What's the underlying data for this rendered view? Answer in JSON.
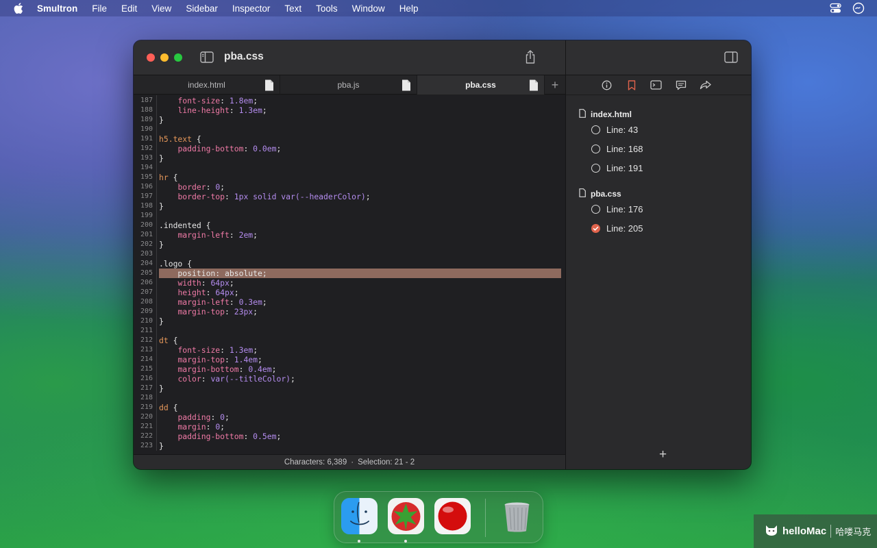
{
  "menubar": {
    "app": "Smultron",
    "items": [
      "File",
      "Edit",
      "View",
      "Sidebar",
      "Inspector",
      "Text",
      "Tools",
      "Window",
      "Help"
    ]
  },
  "window": {
    "title": "pba.css",
    "tabs": [
      {
        "label": "index.html",
        "active": false
      },
      {
        "label": "pba.js",
        "active": false
      },
      {
        "label": "pba.css",
        "active": true
      }
    ],
    "add_tab": "+"
  },
  "editor": {
    "highlight_line": "205",
    "lines": [
      {
        "n": "187",
        "tokens": [
          [
            "    ",
            ""
          ],
          [
            "font-size",
            "prop"
          ],
          [
            ": ",
            ""
          ],
          [
            "1.8em",
            "val"
          ],
          [
            ";",
            ""
          ]
        ]
      },
      {
        "n": "188",
        "tokens": [
          [
            "    ",
            ""
          ],
          [
            "line-height",
            "prop"
          ],
          [
            ": ",
            ""
          ],
          [
            "1.3em",
            "val"
          ],
          [
            ";",
            ""
          ]
        ]
      },
      {
        "n": "189",
        "tokens": [
          [
            "}",
            ""
          ]
        ]
      },
      {
        "n": "190",
        "tokens": []
      },
      {
        "n": "191",
        "tokens": [
          [
            "h5.text",
            "sel"
          ],
          [
            " {",
            ""
          ]
        ]
      },
      {
        "n": "192",
        "tokens": [
          [
            "    ",
            ""
          ],
          [
            "padding-bottom",
            "prop"
          ],
          [
            ": ",
            ""
          ],
          [
            "0.0em",
            "val"
          ],
          [
            ";",
            ""
          ]
        ]
      },
      {
        "n": "193",
        "tokens": [
          [
            "}",
            ""
          ]
        ]
      },
      {
        "n": "194",
        "tokens": []
      },
      {
        "n": "195",
        "tokens": [
          [
            "hr",
            "sel"
          ],
          [
            " {",
            ""
          ]
        ]
      },
      {
        "n": "196",
        "tokens": [
          [
            "    ",
            ""
          ],
          [
            "border",
            "prop"
          ],
          [
            ": ",
            ""
          ],
          [
            "0",
            "val"
          ],
          [
            ";",
            ""
          ]
        ]
      },
      {
        "n": "197",
        "tokens": [
          [
            "    ",
            ""
          ],
          [
            "border-top",
            "prop"
          ],
          [
            ": ",
            ""
          ],
          [
            "1px solid var(--headerColor)",
            "val"
          ],
          [
            ";",
            ""
          ]
        ]
      },
      {
        "n": "198",
        "tokens": [
          [
            "}",
            ""
          ]
        ]
      },
      {
        "n": "199",
        "tokens": []
      },
      {
        "n": "200",
        "tokens": [
          [
            ".indented {",
            ""
          ]
        ]
      },
      {
        "n": "201",
        "tokens": [
          [
            "    ",
            ""
          ],
          [
            "margin-left",
            "prop"
          ],
          [
            ": ",
            ""
          ],
          [
            "2em",
            "val"
          ],
          [
            ";",
            ""
          ]
        ]
      },
      {
        "n": "202",
        "tokens": [
          [
            "}",
            ""
          ]
        ]
      },
      {
        "n": "203",
        "tokens": []
      },
      {
        "n": "204",
        "tokens": [
          [
            ".logo {",
            ""
          ]
        ]
      },
      {
        "n": "205",
        "tokens": [
          [
            "    position: absolute;",
            ""
          ]
        ]
      },
      {
        "n": "206",
        "tokens": [
          [
            "    ",
            ""
          ],
          [
            "width",
            "prop"
          ],
          [
            ": ",
            ""
          ],
          [
            "64px",
            "val"
          ],
          [
            ";",
            ""
          ]
        ]
      },
      {
        "n": "207",
        "tokens": [
          [
            "    ",
            ""
          ],
          [
            "height",
            "prop"
          ],
          [
            ": ",
            ""
          ],
          [
            "64px",
            "val"
          ],
          [
            ";",
            ""
          ]
        ]
      },
      {
        "n": "208",
        "tokens": [
          [
            "    ",
            ""
          ],
          [
            "margin-left",
            "prop"
          ],
          [
            ": ",
            ""
          ],
          [
            "0.3em",
            "val"
          ],
          [
            ";",
            ""
          ]
        ]
      },
      {
        "n": "209",
        "tokens": [
          [
            "    ",
            ""
          ],
          [
            "margin-top",
            "prop"
          ],
          [
            ": ",
            ""
          ],
          [
            "23px",
            "val"
          ],
          [
            ";",
            ""
          ]
        ]
      },
      {
        "n": "210",
        "tokens": [
          [
            "}",
            ""
          ]
        ]
      },
      {
        "n": "211",
        "tokens": []
      },
      {
        "n": "212",
        "tokens": [
          [
            "dt",
            "sel"
          ],
          [
            " {",
            ""
          ]
        ]
      },
      {
        "n": "213",
        "tokens": [
          [
            "    ",
            ""
          ],
          [
            "font-size",
            "prop"
          ],
          [
            ": ",
            ""
          ],
          [
            "1.3em",
            "val"
          ],
          [
            ";",
            ""
          ]
        ]
      },
      {
        "n": "214",
        "tokens": [
          [
            "    ",
            ""
          ],
          [
            "margin-top",
            "prop"
          ],
          [
            ": ",
            ""
          ],
          [
            "1.4em",
            "val"
          ],
          [
            ";",
            ""
          ]
        ]
      },
      {
        "n": "215",
        "tokens": [
          [
            "    ",
            ""
          ],
          [
            "margin-bottom",
            "prop"
          ],
          [
            ": ",
            ""
          ],
          [
            "0.4em",
            "val"
          ],
          [
            ";",
            ""
          ]
        ]
      },
      {
        "n": "216",
        "tokens": [
          [
            "    ",
            ""
          ],
          [
            "color",
            "prop"
          ],
          [
            ": ",
            ""
          ],
          [
            "var(--titleColor)",
            "val"
          ],
          [
            ";",
            ""
          ]
        ]
      },
      {
        "n": "217",
        "tokens": [
          [
            "}",
            ""
          ]
        ]
      },
      {
        "n": "218",
        "tokens": []
      },
      {
        "n": "219",
        "tokens": [
          [
            "dd",
            "sel"
          ],
          [
            " {",
            ""
          ]
        ]
      },
      {
        "n": "220",
        "tokens": [
          [
            "    ",
            ""
          ],
          [
            "padding",
            "prop"
          ],
          [
            ": ",
            ""
          ],
          [
            "0",
            "val"
          ],
          [
            ";",
            ""
          ]
        ]
      },
      {
        "n": "221",
        "tokens": [
          [
            "    ",
            ""
          ],
          [
            "margin",
            "prop"
          ],
          [
            ": ",
            ""
          ],
          [
            "0",
            "val"
          ],
          [
            ";",
            ""
          ]
        ]
      },
      {
        "n": "222",
        "tokens": [
          [
            "    ",
            ""
          ],
          [
            "padding-bottom",
            "prop"
          ],
          [
            ": ",
            ""
          ],
          [
            "0.5em",
            "val"
          ],
          [
            ";",
            ""
          ]
        ]
      },
      {
        "n": "223",
        "tokens": [
          [
            "}",
            ""
          ]
        ]
      }
    ]
  },
  "statusbar": {
    "characters": "Characters: 6,389",
    "separator": "·",
    "selection": "Selection: 21 - 2"
  },
  "inspector": {
    "tools": [
      "info-icon",
      "bookmark-icon",
      "terminal-icon",
      "comment-icon",
      "share-arrow-icon"
    ],
    "groups": [
      {
        "file": "index.html",
        "bookmarks": [
          {
            "label": "Line: 43",
            "checked": false
          },
          {
            "label": "Line: 168",
            "checked": false
          },
          {
            "label": "Line: 191",
            "checked": false
          }
        ]
      },
      {
        "file": "pba.css",
        "bookmarks": [
          {
            "label": "Line: 176",
            "checked": false
          },
          {
            "label": "Line: 205",
            "checked": true
          }
        ]
      }
    ],
    "add": "+"
  },
  "dock": {
    "apps": [
      "finder-icon",
      "smultron-icon",
      "red-ball-app-icon"
    ],
    "trash": "trash-icon"
  },
  "watermark": {
    "brand": "helloMac",
    "sub": "哈喽马克"
  },
  "colors": {
    "selector": "#e5975a",
    "property": "#ef7aa6",
    "value": "#b58df0",
    "highlight": "#8e6a5e",
    "bookmark_checked": "#e0634c"
  }
}
